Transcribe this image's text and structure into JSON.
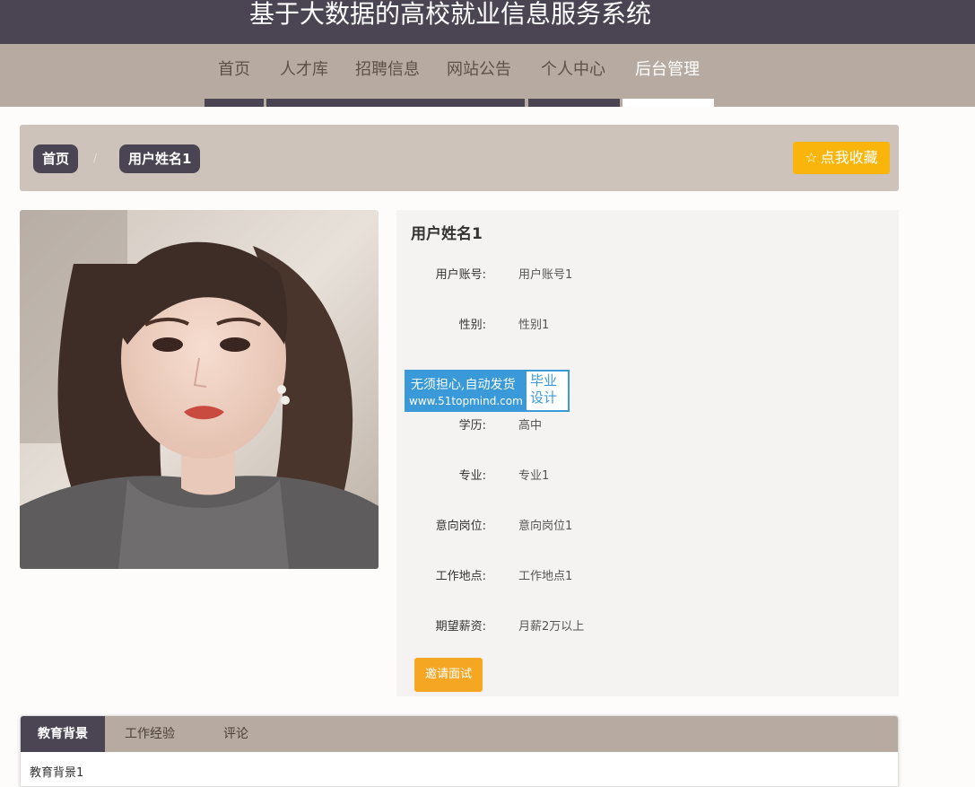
{
  "header": {
    "site_title": "基于大数据的高校就业信息服务系统"
  },
  "nav": {
    "items": [
      {
        "label": "首页",
        "active": false
      },
      {
        "label": "人才库",
        "active": false
      },
      {
        "label": "招聘信息",
        "active": false
      },
      {
        "label": "网站公告",
        "active": false
      },
      {
        "label": "个人中心",
        "active": false
      },
      {
        "label": "后台管理",
        "active": true
      }
    ]
  },
  "breadcrumb": {
    "home": "首页",
    "separator": "/",
    "current": "用户姓名1"
  },
  "favorite_button": {
    "icon": "star-outline-icon",
    "label": "点我收藏"
  },
  "profile": {
    "name": "用户姓名1",
    "fields": [
      {
        "label": "用户账号:",
        "value": "用户账号1"
      },
      {
        "label": "性别:",
        "value": "性别1"
      },
      {
        "label": "学历:",
        "value": "高中"
      },
      {
        "label": "专业:",
        "value": "专业1"
      },
      {
        "label": "意向岗位:",
        "value": "意向岗位1"
      },
      {
        "label": "工作地点:",
        "value": "工作地点1"
      },
      {
        "label": "期望薪资:",
        "value": "月薪2万以上"
      }
    ],
    "invite_button": "邀请面试"
  },
  "watermark": {
    "line1": "无须担心,自动发货",
    "line2": "www.51topmind.com",
    "right": "毕业设计"
  },
  "tabs": {
    "items": [
      {
        "label": "教育背景",
        "active": true
      },
      {
        "label": "工作经验",
        "active": false
      },
      {
        "label": "评论",
        "active": false
      }
    ],
    "content": "教育背景1"
  },
  "colors": {
    "primary": "#4b4452",
    "nav_bg": "#b7aba1",
    "accent": "#f9b50b",
    "invite": "#f5a623"
  }
}
